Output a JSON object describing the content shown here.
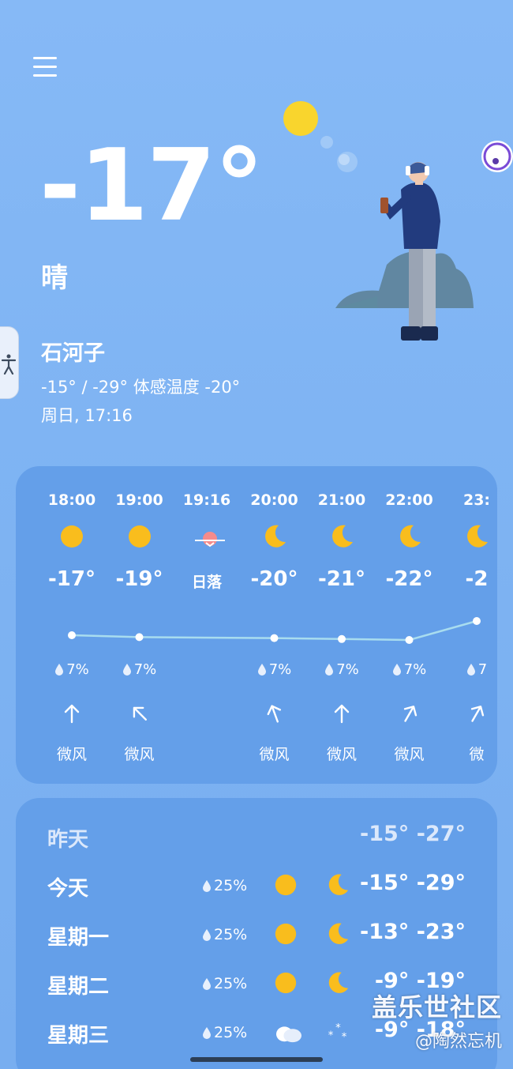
{
  "current": {
    "temperature": "-17°",
    "condition": "晴",
    "city": "石河子",
    "range": "-15° / -29° 体感温度 -20°",
    "datetime": "周日, 17:16"
  },
  "hourly": [
    {
      "time": "18:00",
      "icon": "sun-icon",
      "temp": "-17°",
      "precip": "7%",
      "wind": "微风",
      "arrow": "up"
    },
    {
      "time": "19:00",
      "icon": "sun-icon",
      "temp": "-19°",
      "precip": "7%",
      "wind": "微风",
      "arrow": "up-left"
    },
    {
      "time": "19:16",
      "icon": "sunset-icon",
      "label": "日落"
    },
    {
      "time": "20:00",
      "icon": "moon-icon",
      "temp": "-20°",
      "precip": "7%",
      "wind": "微风",
      "arrow": "up-left-slight"
    },
    {
      "time": "21:00",
      "icon": "moon-icon",
      "temp": "-21°",
      "precip": "7%",
      "wind": "微风",
      "arrow": "up"
    },
    {
      "time": "22:00",
      "icon": "moon-icon",
      "temp": "-22°",
      "precip": "7%",
      "wind": "微风",
      "arrow": "up-right"
    },
    {
      "time": "23:",
      "icon": "moon-icon",
      "temp": "-2",
      "precip": "7",
      "wind": "微",
      "arrow": "up-right"
    }
  ],
  "daily": [
    {
      "day": "昨天",
      "temps": "-15° -27°",
      "muted": true
    },
    {
      "day": "今天",
      "precip": "25%",
      "day_icon": "sun-icon",
      "night_icon": "moon-icon",
      "temps": "-15° -29°"
    },
    {
      "day": "星期一",
      "precip": "25%",
      "day_icon": "sun-icon",
      "night_icon": "moon-icon",
      "temps": "-13° -23°"
    },
    {
      "day": "星期二",
      "precip": "25%",
      "day_icon": "sun-icon",
      "night_icon": "moon-icon",
      "temps": "-9° -19°"
    },
    {
      "day": "星期三",
      "precip": "25%",
      "day_icon": "cloud-icon",
      "night_icon": "snow-icon",
      "temps": "-9° -18°"
    }
  ],
  "watermark": {
    "line1": "盖乐世社区",
    "line2": "@陶然忘机"
  },
  "colors": {
    "sun": "#f9bd1d",
    "card": "#649fe9",
    "graph_line": "#a8dcef"
  }
}
